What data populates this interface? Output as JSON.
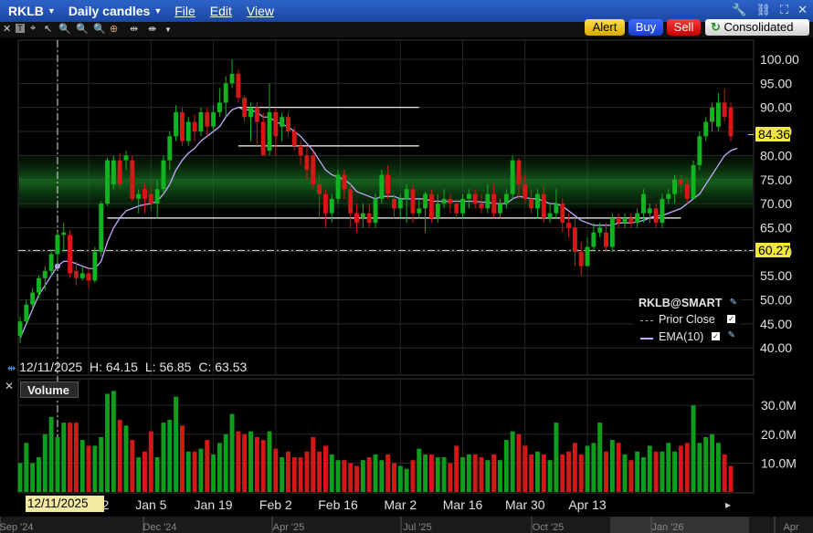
{
  "window": {
    "symbol": "RKLB",
    "period": "Daily candles",
    "menus": [
      "File",
      "Edit",
      "View"
    ]
  },
  "toolbar": {
    "tools": [
      "cursor-icon",
      "text-tool-icon",
      "crosshair-icon",
      "zoom-in-icon",
      "zoom-out-icon",
      "target-icon",
      "fit-icon",
      "pan-icon",
      "chevron-down-icon"
    ]
  },
  "buttons": {
    "alert": "Alert",
    "buy": "Buy",
    "sell": "Sell",
    "exchange": "Consolidated",
    "colors": {
      "alert": "#e0b800",
      "buy": "#1d4fd6",
      "sell": "#d01010"
    }
  },
  "price_labels": {
    "last": "84.36",
    "prior_close": "60.27"
  },
  "legend": {
    "title": "RKLB@SMART",
    "prior_close": "Prior Close",
    "ema": "EMA(10)"
  },
  "info": {
    "date": "12/11/2025",
    "high_label": "H:",
    "high": "64.15",
    "low_label": "L:",
    "low": "56.85",
    "close_label": "C:",
    "close": "63.53"
  },
  "volume_label": "Volume",
  "cursor_date": "12/11/2025",
  "x_ticks": [
    "Dec 22",
    "Jan 5",
    "Jan 19",
    "Feb 2",
    "Feb 16",
    "Mar 2",
    "Mar 16",
    "Mar 30",
    "Apr 13"
  ],
  "overview_ticks": [
    "Sep '24",
    "Dec '24",
    "Apr '25",
    "Jul '25",
    "Oct '25",
    "Jan '26",
    "Apr"
  ],
  "chart_data": {
    "type": "candlestick",
    "y_ticks": [
      100,
      95,
      90,
      85,
      80,
      75,
      70,
      65,
      60,
      55,
      50,
      45,
      40
    ],
    "ylim": [
      37,
      102
    ],
    "volume_ticks": [
      "30.0M",
      "20.0M",
      "10.0M"
    ],
    "volume_ylim": [
      0,
      37
    ],
    "candles": [
      {
        "o": 42.5,
        "c": 45.5,
        "h": 46.5,
        "l": 41,
        "v": 10
      },
      {
        "o": 45.5,
        "c": 49,
        "h": 50,
        "l": 45,
        "v": 17
      },
      {
        "o": 49,
        "c": 51.5,
        "h": 52.5,
        "l": 48,
        "v": 10
      },
      {
        "o": 51.5,
        "c": 54.5,
        "h": 55,
        "l": 50.5,
        "v": 12
      },
      {
        "o": 54.5,
        "c": 56,
        "h": 57,
        "l": 52,
        "v": 20
      },
      {
        "o": 56,
        "c": 59.5,
        "h": 60.5,
        "l": 55,
        "v": 26
      },
      {
        "o": 59.5,
        "c": 63.5,
        "h": 64.15,
        "l": 56.85,
        "v": 19
      },
      {
        "o": 63.5,
        "c": 64,
        "h": 66,
        "l": 60,
        "v": 24
      },
      {
        "o": 63.5,
        "c": 55.5,
        "h": 64.5,
        "l": 54.5,
        "v": 24
      },
      {
        "o": 56,
        "c": 54.5,
        "h": 58,
        "l": 53,
        "v": 24
      },
      {
        "o": 54.5,
        "c": 55.5,
        "h": 57,
        "l": 54,
        "v": 18
      },
      {
        "o": 55.5,
        "c": 54,
        "h": 56.5,
        "l": 52.5,
        "v": 16
      },
      {
        "o": 54,
        "c": 60,
        "h": 61,
        "l": 53.5,
        "v": 16
      },
      {
        "o": 60,
        "c": 70,
        "h": 70.5,
        "l": 59,
        "v": 19
      },
      {
        "o": 70,
        "c": 79,
        "h": 79.5,
        "l": 69.5,
        "v": 34
      },
      {
        "o": 74,
        "c": 79,
        "h": 80,
        "l": 73,
        "v": 35
      },
      {
        "o": 79,
        "c": 74,
        "h": 80.5,
        "l": 73,
        "v": 25
      },
      {
        "o": 79,
        "c": 80,
        "h": 81,
        "l": 77,
        "v": 23
      },
      {
        "o": 79,
        "c": 71,
        "h": 80,
        "l": 70.5,
        "v": 18
      },
      {
        "o": 71,
        "c": 72,
        "h": 73,
        "l": 68,
        "v": 12
      },
      {
        "o": 73,
        "c": 71,
        "h": 74,
        "l": 68,
        "v": 14
      },
      {
        "o": 72,
        "c": 70,
        "h": 73.5,
        "l": 68.5,
        "v": 21
      },
      {
        "o": 70,
        "c": 73,
        "h": 75,
        "l": 67,
        "v": 12
      },
      {
        "o": 73,
        "c": 79,
        "h": 80,
        "l": 72,
        "v": 24
      },
      {
        "o": 79,
        "c": 84,
        "h": 85,
        "l": 77,
        "v": 25
      },
      {
        "o": 84,
        "c": 89,
        "h": 90.5,
        "l": 83,
        "v": 33
      },
      {
        "o": 89,
        "c": 83,
        "h": 90,
        "l": 82,
        "v": 23
      },
      {
        "o": 83,
        "c": 87,
        "h": 88,
        "l": 82,
        "v": 14
      },
      {
        "o": 87,
        "c": 85,
        "h": 88.5,
        "l": 83,
        "v": 14
      },
      {
        "o": 85,
        "c": 89,
        "h": 90,
        "l": 84,
        "v": 15
      },
      {
        "o": 89,
        "c": 86,
        "h": 90,
        "l": 84,
        "v": 18
      },
      {
        "o": 86,
        "c": 89,
        "h": 90.5,
        "l": 85,
        "v": 13
      },
      {
        "o": 89,
        "c": 91,
        "h": 94,
        "l": 88,
        "v": 17
      },
      {
        "o": 91,
        "c": 95,
        "h": 96.5,
        "l": 88,
        "v": 20
      },
      {
        "o": 95,
        "c": 97,
        "h": 100,
        "l": 94,
        "v": 27
      },
      {
        "o": 97,
        "c": 92,
        "h": 98,
        "l": 91,
        "v": 21
      },
      {
        "o": 92,
        "c": 88,
        "h": 92.5,
        "l": 87,
        "v": 20
      },
      {
        "o": 88,
        "c": 90,
        "h": 91,
        "l": 83,
        "v": 21
      },
      {
        "o": 90,
        "c": 87,
        "h": 91,
        "l": 82,
        "v": 19
      },
      {
        "o": 87,
        "c": 80,
        "h": 89,
        "l": 81,
        "v": 18
      },
      {
        "o": 81,
        "c": 89,
        "h": 95,
        "l": 80,
        "v": 21
      },
      {
        "o": 89,
        "c": 84,
        "h": 90,
        "l": 80,
        "v": 15
      },
      {
        "o": 86,
        "c": 88,
        "h": 89,
        "l": 83,
        "v": 12
      },
      {
        "o": 88,
        "c": 85,
        "h": 89,
        "l": 84,
        "v": 14
      },
      {
        "o": 85,
        "c": 82,
        "h": 86,
        "l": 81,
        "v": 12
      },
      {
        "o": 82,
        "c": 80,
        "h": 83,
        "l": 78,
        "v": 12
      },
      {
        "o": 80,
        "c": 77,
        "h": 82,
        "l": 75,
        "v": 14
      },
      {
        "o": 80,
        "c": 74,
        "h": 81,
        "l": 73,
        "v": 19
      },
      {
        "o": 74,
        "c": 72,
        "h": 76,
        "l": 67,
        "v": 14
      },
      {
        "o": 72,
        "c": 68,
        "h": 73,
        "l": 65,
        "v": 16
      },
      {
        "o": 68,
        "c": 71,
        "h": 72,
        "l": 66,
        "v": 13
      },
      {
        "o": 71,
        "c": 76,
        "h": 77,
        "l": 70,
        "v": 11
      },
      {
        "o": 76,
        "c": 73,
        "h": 77,
        "l": 71,
        "v": 11
      },
      {
        "o": 73,
        "c": 68,
        "h": 74,
        "l": 65,
        "v": 10
      },
      {
        "o": 68,
        "c": 66,
        "h": 70,
        "l": 64,
        "v": 9
      },
      {
        "o": 67,
        "c": 68,
        "h": 70,
        "l": 65,
        "v": 11
      },
      {
        "o": 68,
        "c": 66,
        "h": 70,
        "l": 65,
        "v": 12
      },
      {
        "o": 66,
        "c": 71,
        "h": 72,
        "l": 65,
        "v": 13
      },
      {
        "o": 71,
        "c": 76,
        "h": 77,
        "l": 70,
        "v": 11
      },
      {
        "o": 76,
        "c": 72,
        "h": 78,
        "l": 71,
        "v": 13
      },
      {
        "o": 71,
        "c": 69,
        "h": 72,
        "l": 67,
        "v": 10
      },
      {
        "o": 69,
        "c": 71,
        "h": 72,
        "l": 67,
        "v": 9
      },
      {
        "o": 71,
        "c": 73,
        "h": 74,
        "l": 66,
        "v": 8
      },
      {
        "o": 73,
        "c": 68,
        "h": 74,
        "l": 66,
        "v": 11
      },
      {
        "o": 68,
        "c": 69,
        "h": 71,
        "l": 67,
        "v": 15
      },
      {
        "o": 69,
        "c": 72,
        "h": 72.5,
        "l": 64,
        "v": 13
      },
      {
        "o": 72,
        "c": 67,
        "h": 73,
        "l": 66,
        "v": 13
      },
      {
        "o": 67,
        "c": 70,
        "h": 72,
        "l": 66,
        "v": 12
      },
      {
        "o": 70,
        "c": 71,
        "h": 73,
        "l": 69,
        "v": 12
      },
      {
        "o": 71,
        "c": 70,
        "h": 72,
        "l": 68,
        "v": 10
      },
      {
        "o": 70,
        "c": 68,
        "h": 71,
        "l": 67,
        "v": 16
      },
      {
        "o": 68,
        "c": 71,
        "h": 72,
        "l": 67,
        "v": 12
      },
      {
        "o": 71,
        "c": 72,
        "h": 73,
        "l": 69,
        "v": 13
      },
      {
        "o": 72,
        "c": 70,
        "h": 73,
        "l": 69,
        "v": 13
      },
      {
        "o": 70,
        "c": 69,
        "h": 72,
        "l": 68,
        "v": 12
      },
      {
        "o": 69,
        "c": 72,
        "h": 74,
        "l": 68,
        "v": 11
      },
      {
        "o": 72,
        "c": 68,
        "h": 74,
        "l": 67,
        "v": 13
      },
      {
        "o": 68,
        "c": 70,
        "h": 71,
        "l": 67,
        "v": 11
      },
      {
        "o": 70,
        "c": 72,
        "h": 73,
        "l": 69,
        "v": 18
      },
      {
        "o": 72,
        "c": 79,
        "h": 80,
        "l": 71,
        "v": 21
      },
      {
        "o": 79,
        "c": 74,
        "h": 79.5,
        "l": 71,
        "v": 20
      },
      {
        "o": 74,
        "c": 71,
        "h": 76,
        "l": 70,
        "v": 16
      },
      {
        "o": 71,
        "c": 69,
        "h": 73,
        "l": 68,
        "v": 13
      },
      {
        "o": 69,
        "c": 72,
        "h": 73,
        "l": 67,
        "v": 14
      },
      {
        "o": 72,
        "c": 67,
        "h": 74,
        "l": 66,
        "v": 13
      },
      {
        "o": 67,
        "c": 68,
        "h": 70,
        "l": 66,
        "v": 11
      },
      {
        "o": 68,
        "c": 70,
        "h": 73,
        "l": 67,
        "v": 24
      },
      {
        "o": 70,
        "c": 66,
        "h": 71,
        "l": 64,
        "v": 13
      },
      {
        "o": 66,
        "c": 65,
        "h": 68,
        "l": 63,
        "v": 14
      },
      {
        "o": 65,
        "c": 60,
        "h": 67,
        "l": 57,
        "v": 17
      },
      {
        "o": 60,
        "c": 57,
        "h": 62,
        "l": 55,
        "v": 13
      },
      {
        "o": 57,
        "c": 61,
        "h": 63,
        "l": 57,
        "v": 16
      },
      {
        "o": 61,
        "c": 64,
        "h": 66,
        "l": 60,
        "v": 17
      },
      {
        "o": 64,
        "c": 65,
        "h": 66,
        "l": 63,
        "v": 24
      },
      {
        "o": 64,
        "c": 61,
        "h": 66,
        "l": 60,
        "v": 14
      },
      {
        "o": 61,
        "c": 67,
        "h": 68,
        "l": 60,
        "v": 18
      },
      {
        "o": 67,
        "c": 66,
        "h": 68,
        "l": 65,
        "v": 17
      },
      {
        "o": 66,
        "c": 67,
        "h": 68,
        "l": 65,
        "v": 13
      },
      {
        "o": 67,
        "c": 66,
        "h": 68,
        "l": 65,
        "v": 11
      },
      {
        "o": 66,
        "c": 68,
        "h": 69,
        "l": 65,
        "v": 14
      },
      {
        "o": 68,
        "c": 72,
        "h": 73,
        "l": 66,
        "v": 12
      },
      {
        "o": 68,
        "c": 69,
        "h": 70,
        "l": 66,
        "v": 16
      },
      {
        "o": 69,
        "c": 66,
        "h": 70,
        "l": 65,
        "v": 14
      },
      {
        "o": 66,
        "c": 71,
        "h": 72,
        "l": 65,
        "v": 14
      },
      {
        "o": 71,
        "c": 72,
        "h": 73,
        "l": 70,
        "v": 17
      },
      {
        "o": 72,
        "c": 75,
        "h": 76,
        "l": 70,
        "v": 14
      },
      {
        "o": 75,
        "c": 74,
        "h": 76,
        "l": 72,
        "v": 16
      },
      {
        "o": 74,
        "c": 71,
        "h": 75,
        "l": 70,
        "v": 17
      },
      {
        "o": 71,
        "c": 78,
        "h": 79,
        "l": 71,
        "v": 30
      },
      {
        "o": 78,
        "c": 84,
        "h": 85,
        "l": 77,
        "v": 17
      },
      {
        "o": 84,
        "c": 87,
        "h": 88,
        "l": 83,
        "v": 19
      },
      {
        "o": 87,
        "c": 90,
        "h": 91,
        "l": 85,
        "v": 20
      },
      {
        "o": 86,
        "c": 91,
        "h": 93,
        "l": 85,
        "v": 17
      },
      {
        "o": 91,
        "c": 88,
        "h": 94,
        "l": 87,
        "v": 13
      },
      {
        "o": 90,
        "c": 84,
        "h": 91,
        "l": 83,
        "v": 9
      }
    ],
    "ema10": [
      42,
      45,
      48,
      51,
      53,
      55,
      57,
      58,
      58,
      57.5,
      57,
      56.5,
      56.5,
      58,
      62,
      65,
      67,
      68.5,
      69,
      69.5,
      69.8,
      70,
      70.5,
      72,
      74,
      77,
      79,
      80.5,
      81.5,
      83,
      84,
      85,
      86,
      88,
      89.5,
      90,
      89.5,
      89.5,
      89,
      88,
      88,
      87,
      86.5,
      86,
      85,
      84,
      82.5,
      81,
      79,
      77,
      76,
      75.5,
      75,
      74,
      72.5,
      72,
      71.5,
      71,
      71.5,
      71.5,
      71.5,
      71,
      71,
      71,
      71,
      71,
      70.5,
      70.5,
      70.5,
      70.5,
      70.5,
      70.5,
      70.5,
      70.5,
      70.3,
      70.3,
      70,
      70,
      70,
      71,
      71.5,
      71.3,
      71,
      71,
      70.5,
      70,
      70,
      69.5,
      68.5,
      67.5,
      66.5,
      66,
      65.5,
      65.5,
      65.5,
      65.5,
      66,
      66,
      66,
      66.2,
      66.5,
      67,
      67.5,
      67.5,
      68,
      68.5,
      69,
      70,
      71,
      72,
      74,
      76,
      78,
      80,
      81,
      81.5
    ],
    "volume_colors": {
      "up": "#0f9d1e",
      "down": "#d41818"
    },
    "bands": [
      {
        "from": 69,
        "to": 80,
        "color": "#1e8f2a"
      }
    ],
    "horizontal_lines": [
      {
        "y": 90,
        "from": 35,
        "to": 64,
        "color": "#ffffff"
      },
      {
        "y": 82,
        "from": 35,
        "to": 64,
        "color": "#ffffff"
      },
      {
        "y": 67,
        "from": 14,
        "to": 106,
        "color": "#ffffff"
      },
      {
        "y": 84,
        "from": 136,
        "to": 141,
        "color": "#ffffff"
      }
    ]
  }
}
